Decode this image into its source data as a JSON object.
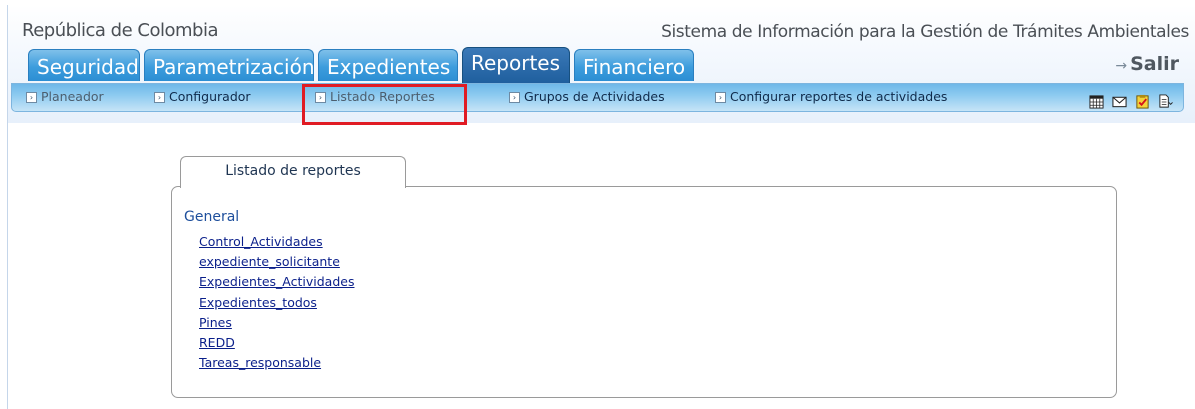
{
  "header": {
    "gov_title": "República de Colombia",
    "system_title": "Sistema de Información para la Gestión de Trámites Ambientales"
  },
  "tabs": [
    {
      "label": "Seguridad",
      "active": false
    },
    {
      "label": "Parametrización",
      "active": false
    },
    {
      "label": "Expedientes",
      "active": false
    },
    {
      "label": "Reportes",
      "active": true
    },
    {
      "label": "Financiero",
      "active": false
    }
  ],
  "salir": {
    "label": "Salir",
    "icon": "arrow-icon"
  },
  "subnav": {
    "items": [
      {
        "label": "Planeador"
      },
      {
        "label": "Configurador"
      },
      {
        "label": "Listado Reportes"
      },
      {
        "label": "Grupos de Actividades"
      },
      {
        "label": "Configurar reportes de actividades"
      }
    ],
    "icons": [
      "calendar-icon",
      "mail-icon",
      "task-icon",
      "document-icon"
    ]
  },
  "panel": {
    "tab_label": "Listado de reportes",
    "group_title": "General",
    "reports": [
      "Control_Actividades",
      "expediente_solicitante",
      "Expedientes_Actividades",
      "Expedientes_todos",
      "Pines",
      "REDD",
      "Tareas_responsable"
    ]
  },
  "colors": {
    "tab_blue": "#3d9ddd",
    "tab_active": "#1f5f9e",
    "highlight_red": "#e01b24",
    "link": "#0a1f8a"
  }
}
